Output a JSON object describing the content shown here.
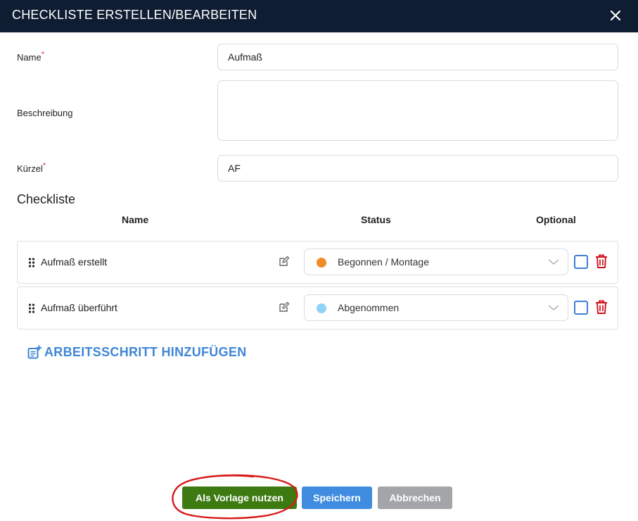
{
  "dialog": {
    "title": "CHECKLISTE ERSTELLEN/BEARBEITEN"
  },
  "form": {
    "name": {
      "label": "Name",
      "required_mark": "*",
      "value": "Aufmaß"
    },
    "description": {
      "label": "Beschreibung",
      "value": ""
    },
    "abbreviation": {
      "label": "Kürzel",
      "required_mark": "*",
      "value": "AF"
    }
  },
  "checklist": {
    "title": "Checkliste",
    "columns": {
      "name": "Name",
      "status": "Status",
      "optional": "Optional"
    },
    "rows": [
      {
        "name": "Aufmaß erstellt",
        "status": "Begonnen / Montage",
        "status_color": "#f28c28",
        "optional": false
      },
      {
        "name": "Aufmaß überführt",
        "status": "Abgenommen",
        "status_color": "#8fd3f8",
        "optional": false
      }
    ],
    "add_step_label": "ARBEITSSCHRITT HINZUFÜGEN"
  },
  "footer": {
    "use_template_label": "Als Vorlage nutzen",
    "save_label": "Speichern",
    "cancel_label": "Abbrechen"
  },
  "colors": {
    "header_bg": "#0f1d33",
    "accent_blue": "#3f86d6",
    "template_green": "#3d7a12",
    "cancel_grey": "#a3a5a8",
    "delete_red": "#d0101a",
    "annotation_red": "#d81b1b"
  },
  "icons": {
    "close": "close-icon",
    "drag": "drag-handle-icon",
    "edit": "edit-icon",
    "chevron": "chevron-down-icon",
    "trash": "trash-icon",
    "add_step": "add-list-icon"
  }
}
